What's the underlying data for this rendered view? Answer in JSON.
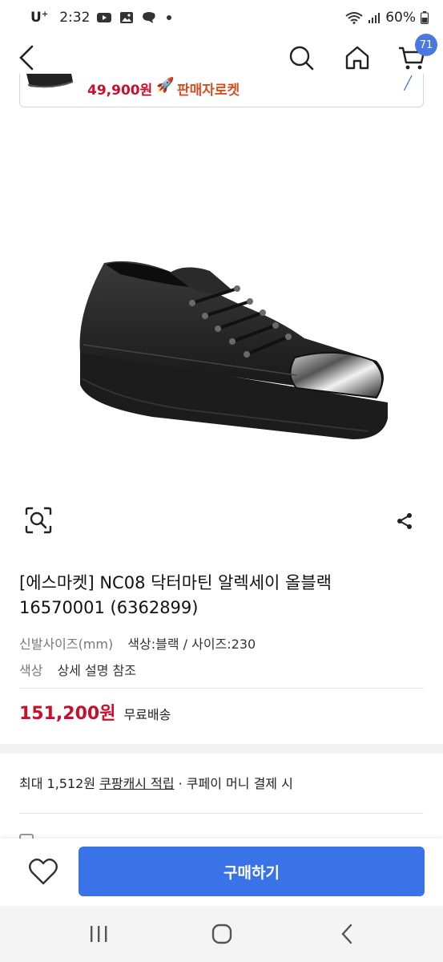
{
  "status_bar": {
    "carrier": "U",
    "carrier_sup": "+",
    "time": "2:32",
    "battery": "60%"
  },
  "nav": {
    "cart_count": "71"
  },
  "promo_card": {
    "price": "49,900원",
    "tag": "판매자로켓"
  },
  "product": {
    "title_line1": "[에스마켓] NC08 닥터마틴 알렉세이 올블랙",
    "title_line2": "16570001 (6362899)",
    "size_key": "신발사이즈(mm)",
    "size_value": "색상:블랙 / 사이즈:230",
    "color_key": "색상",
    "color_value": "상세 설명 참조",
    "price": "151,200원",
    "shipping": "무료배송"
  },
  "cash": {
    "prefix": "최대 1,512원 ",
    "link": "쿠팡캐시 적립",
    "suffix": " · 쿠페이 머니 결제 시"
  },
  "bottom_bar": {
    "buy_label": "구매하기"
  },
  "colors": {
    "accent": "#3a73e8",
    "price_red": "#c8102e",
    "badge": "#4a78e0"
  }
}
